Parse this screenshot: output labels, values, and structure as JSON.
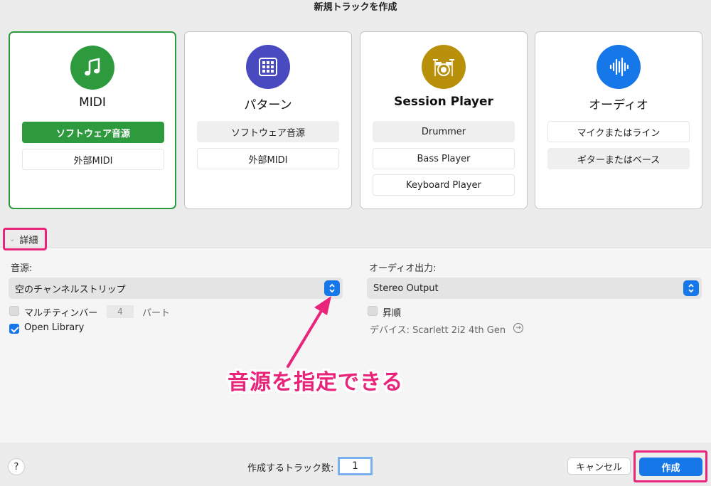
{
  "dialog": {
    "title": "新規トラックを作成"
  },
  "cards": [
    {
      "title": "MIDI",
      "icon": "music-note-icon",
      "color": "#2e9a3e",
      "options": [
        "ソフトウェア音源",
        "外部MIDI"
      ]
    },
    {
      "title": "パターン",
      "icon": "grid-pad-icon",
      "color": "#4a4ac0",
      "options": [
        "ソフトウェア音源",
        "外部MIDI"
      ]
    },
    {
      "title": "Session Player",
      "icon": "drum-kit-icon",
      "color": "#b8900a",
      "options": [
        "Drummer",
        "Bass Player",
        "Keyboard Player"
      ]
    },
    {
      "title": "オーディオ",
      "icon": "waveform-icon",
      "color": "#1677e8",
      "options": [
        "マイクまたはライン",
        "ギターまたはベース"
      ]
    }
  ],
  "details": {
    "toggle_label": "詳細",
    "instrument_label": "音源:",
    "instrument_value": "空のチャンネルストリップ",
    "multitimbral_label": "マルチティンバー",
    "multitimbral_count": "4",
    "parts_label": "パート",
    "open_library_label": "Open Library",
    "audio_output_label": "オーディオ出力:",
    "audio_output_value": "Stereo Output",
    "ascending_label": "昇順",
    "device_label": "デバイス: Scarlett 2i2 4th Gen"
  },
  "annotation": {
    "text": "音源を指定できる",
    "color": "#e8257a"
  },
  "footer": {
    "help_label": "?",
    "track_count_label": "作成するトラック数:",
    "track_count_value": "1",
    "cancel_label": "キャンセル",
    "create_label": "作成"
  },
  "colors": {
    "accent": "#1677e8",
    "highlight": "#e8257a",
    "midi_green": "#2e9a3e"
  }
}
